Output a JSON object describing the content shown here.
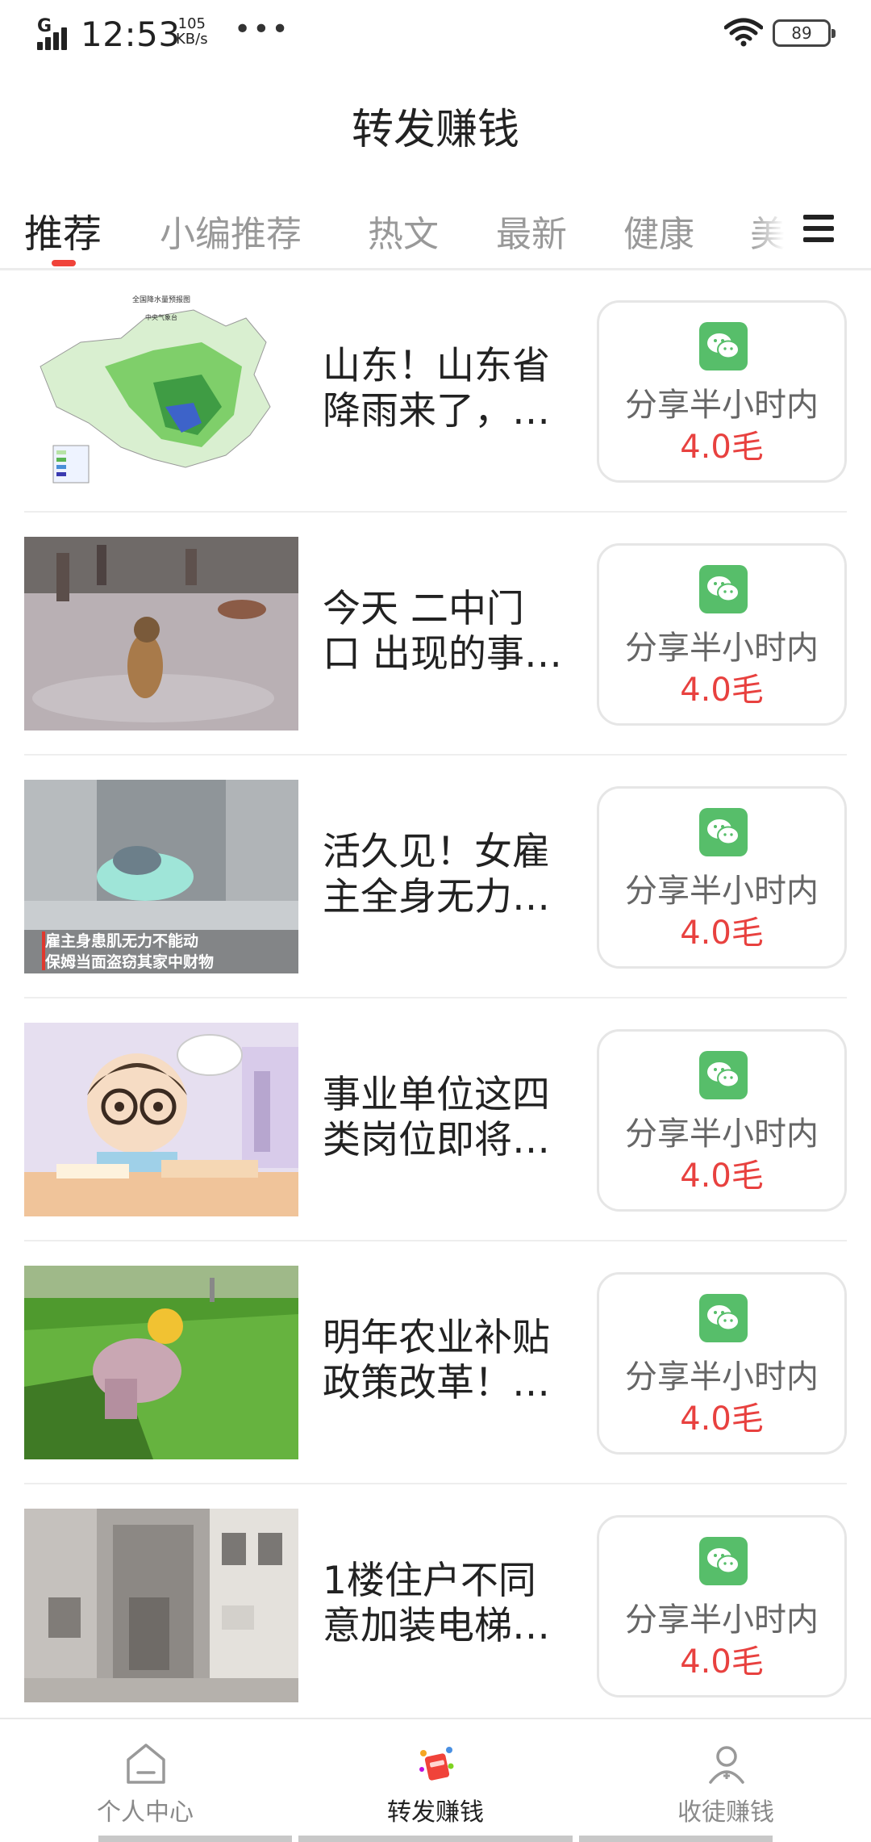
{
  "status_bar": {
    "network": "G",
    "time": "12:53",
    "speed_value": "105",
    "speed_unit": "KB/s",
    "more": "•••",
    "battery": "89"
  },
  "header": {
    "title": "转发赚钱"
  },
  "tabs": [
    {
      "label": "推荐",
      "active": true
    },
    {
      "label": "小编推荐"
    },
    {
      "label": "热文"
    },
    {
      "label": "最新"
    },
    {
      "label": "健康"
    },
    {
      "label": "美"
    }
  ],
  "menu_icon": "menu-icon",
  "articles": [
    {
      "line1": "山东！山东省",
      "line2": "降雨来了，…",
      "share_label": "分享半小时内",
      "reward": "4.0毛",
      "thumb_caption_1": "全国降水量预报图",
      "thumb_caption_2": "中央气象台"
    },
    {
      "line1": "今天 二中门",
      "line2": "口 出现的事…",
      "share_label": "分享半小时内",
      "reward": "4.0毛"
    },
    {
      "line1": "活久见！女雇",
      "line2": "主全身无力…",
      "share_label": "分享半小时内",
      "reward": "4.0毛",
      "thumb_caption_1": "雇主身患肌无力不能动",
      "thumb_caption_2": "保姆当面盗窃其家中财物"
    },
    {
      "line1": "事业单位这四",
      "line2": "类岗位即将…",
      "share_label": "分享半小时内",
      "reward": "4.0毛"
    },
    {
      "line1": "明年农业补贴",
      "line2": "政策改革！…",
      "share_label": "分享半小时内",
      "reward": "4.0毛"
    },
    {
      "line1": "1楼住户不同",
      "line2": "意加装电梯…",
      "share_label": "分享半小时内",
      "reward": "4.0毛"
    }
  ],
  "bottom_nav": [
    {
      "label": "个人中心",
      "icon": "home-icon"
    },
    {
      "label": "转发赚钱",
      "icon": "share-money-icon",
      "active": true
    },
    {
      "label": "收徒赚钱",
      "icon": "user-add-icon"
    }
  ],
  "colors": {
    "accent_red": "#e8413f",
    "wechat_green": "#57be6a"
  }
}
